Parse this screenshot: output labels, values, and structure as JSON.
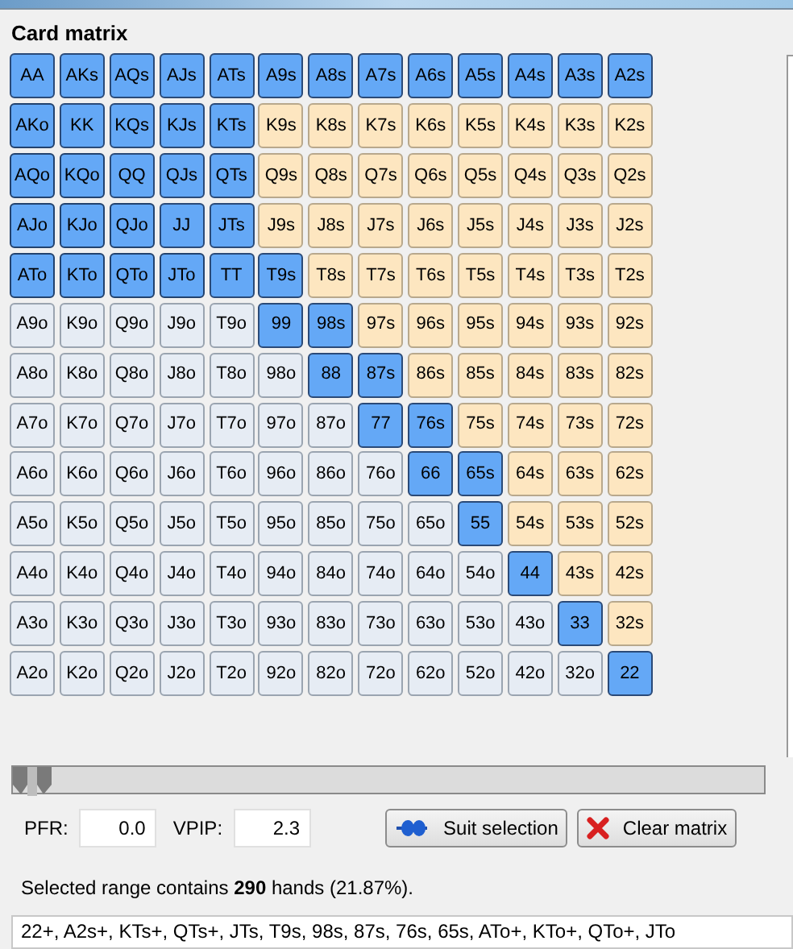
{
  "title": "Card matrix",
  "matrix": [
    [
      {
        "label": "AA",
        "kind": "pair",
        "selected": true
      },
      {
        "label": "AKs",
        "kind": "suited",
        "selected": true
      },
      {
        "label": "AQs",
        "kind": "suited",
        "selected": true
      },
      {
        "label": "AJs",
        "kind": "suited",
        "selected": true
      },
      {
        "label": "ATs",
        "kind": "suited",
        "selected": true
      },
      {
        "label": "A9s",
        "kind": "suited",
        "selected": true
      },
      {
        "label": "A8s",
        "kind": "suited",
        "selected": true
      },
      {
        "label": "A7s",
        "kind": "suited",
        "selected": true
      },
      {
        "label": "A6s",
        "kind": "suited",
        "selected": true
      },
      {
        "label": "A5s",
        "kind": "suited",
        "selected": true
      },
      {
        "label": "A4s",
        "kind": "suited",
        "selected": true
      },
      {
        "label": "A3s",
        "kind": "suited",
        "selected": true
      },
      {
        "label": "A2s",
        "kind": "suited",
        "selected": true
      }
    ],
    [
      {
        "label": "AKo",
        "kind": "offsuit",
        "selected": true
      },
      {
        "label": "KK",
        "kind": "pair",
        "selected": true
      },
      {
        "label": "KQs",
        "kind": "suited",
        "selected": true
      },
      {
        "label": "KJs",
        "kind": "suited",
        "selected": true
      },
      {
        "label": "KTs",
        "kind": "suited",
        "selected": true
      },
      {
        "label": "K9s",
        "kind": "suited",
        "selected": false
      },
      {
        "label": "K8s",
        "kind": "suited",
        "selected": false
      },
      {
        "label": "K7s",
        "kind": "suited",
        "selected": false
      },
      {
        "label": "K6s",
        "kind": "suited",
        "selected": false
      },
      {
        "label": "K5s",
        "kind": "suited",
        "selected": false
      },
      {
        "label": "K4s",
        "kind": "suited",
        "selected": false
      },
      {
        "label": "K3s",
        "kind": "suited",
        "selected": false
      },
      {
        "label": "K2s",
        "kind": "suited",
        "selected": false
      }
    ],
    [
      {
        "label": "AQo",
        "kind": "offsuit",
        "selected": true
      },
      {
        "label": "KQo",
        "kind": "offsuit",
        "selected": true
      },
      {
        "label": "QQ",
        "kind": "pair",
        "selected": true
      },
      {
        "label": "QJs",
        "kind": "suited",
        "selected": true
      },
      {
        "label": "QTs",
        "kind": "suited",
        "selected": true
      },
      {
        "label": "Q9s",
        "kind": "suited",
        "selected": false
      },
      {
        "label": "Q8s",
        "kind": "suited",
        "selected": false
      },
      {
        "label": "Q7s",
        "kind": "suited",
        "selected": false
      },
      {
        "label": "Q6s",
        "kind": "suited",
        "selected": false
      },
      {
        "label": "Q5s",
        "kind": "suited",
        "selected": false
      },
      {
        "label": "Q4s",
        "kind": "suited",
        "selected": false
      },
      {
        "label": "Q3s",
        "kind": "suited",
        "selected": false
      },
      {
        "label": "Q2s",
        "kind": "suited",
        "selected": false
      }
    ],
    [
      {
        "label": "AJo",
        "kind": "offsuit",
        "selected": true
      },
      {
        "label": "KJo",
        "kind": "offsuit",
        "selected": true
      },
      {
        "label": "QJo",
        "kind": "offsuit",
        "selected": true
      },
      {
        "label": "JJ",
        "kind": "pair",
        "selected": true
      },
      {
        "label": "JTs",
        "kind": "suited",
        "selected": true
      },
      {
        "label": "J9s",
        "kind": "suited",
        "selected": false
      },
      {
        "label": "J8s",
        "kind": "suited",
        "selected": false
      },
      {
        "label": "J7s",
        "kind": "suited",
        "selected": false
      },
      {
        "label": "J6s",
        "kind": "suited",
        "selected": false
      },
      {
        "label": "J5s",
        "kind": "suited",
        "selected": false
      },
      {
        "label": "J4s",
        "kind": "suited",
        "selected": false
      },
      {
        "label": "J3s",
        "kind": "suited",
        "selected": false
      },
      {
        "label": "J2s",
        "kind": "suited",
        "selected": false
      }
    ],
    [
      {
        "label": "ATo",
        "kind": "offsuit",
        "selected": true
      },
      {
        "label": "KTo",
        "kind": "offsuit",
        "selected": true
      },
      {
        "label": "QTo",
        "kind": "offsuit",
        "selected": true
      },
      {
        "label": "JTo",
        "kind": "offsuit",
        "selected": true
      },
      {
        "label": "TT",
        "kind": "pair",
        "selected": true
      },
      {
        "label": "T9s",
        "kind": "suited",
        "selected": true
      },
      {
        "label": "T8s",
        "kind": "suited",
        "selected": false
      },
      {
        "label": "T7s",
        "kind": "suited",
        "selected": false
      },
      {
        "label": "T6s",
        "kind": "suited",
        "selected": false
      },
      {
        "label": "T5s",
        "kind": "suited",
        "selected": false
      },
      {
        "label": "T4s",
        "kind": "suited",
        "selected": false
      },
      {
        "label": "T3s",
        "kind": "suited",
        "selected": false
      },
      {
        "label": "T2s",
        "kind": "suited",
        "selected": false
      }
    ],
    [
      {
        "label": "A9o",
        "kind": "offsuit",
        "selected": false
      },
      {
        "label": "K9o",
        "kind": "offsuit",
        "selected": false
      },
      {
        "label": "Q9o",
        "kind": "offsuit",
        "selected": false
      },
      {
        "label": "J9o",
        "kind": "offsuit",
        "selected": false
      },
      {
        "label": "T9o",
        "kind": "offsuit",
        "selected": false
      },
      {
        "label": "99",
        "kind": "pair",
        "selected": true
      },
      {
        "label": "98s",
        "kind": "suited",
        "selected": true
      },
      {
        "label": "97s",
        "kind": "suited",
        "selected": false
      },
      {
        "label": "96s",
        "kind": "suited",
        "selected": false
      },
      {
        "label": "95s",
        "kind": "suited",
        "selected": false
      },
      {
        "label": "94s",
        "kind": "suited",
        "selected": false
      },
      {
        "label": "93s",
        "kind": "suited",
        "selected": false
      },
      {
        "label": "92s",
        "kind": "suited",
        "selected": false
      }
    ],
    [
      {
        "label": "A8o",
        "kind": "offsuit",
        "selected": false
      },
      {
        "label": "K8o",
        "kind": "offsuit",
        "selected": false
      },
      {
        "label": "Q8o",
        "kind": "offsuit",
        "selected": false
      },
      {
        "label": "J8o",
        "kind": "offsuit",
        "selected": false
      },
      {
        "label": "T8o",
        "kind": "offsuit",
        "selected": false
      },
      {
        "label": "98o",
        "kind": "offsuit",
        "selected": false
      },
      {
        "label": "88",
        "kind": "pair",
        "selected": true
      },
      {
        "label": "87s",
        "kind": "suited",
        "selected": true
      },
      {
        "label": "86s",
        "kind": "suited",
        "selected": false
      },
      {
        "label": "85s",
        "kind": "suited",
        "selected": false
      },
      {
        "label": "84s",
        "kind": "suited",
        "selected": false
      },
      {
        "label": "83s",
        "kind": "suited",
        "selected": false
      },
      {
        "label": "82s",
        "kind": "suited",
        "selected": false
      }
    ],
    [
      {
        "label": "A7o",
        "kind": "offsuit",
        "selected": false
      },
      {
        "label": "K7o",
        "kind": "offsuit",
        "selected": false
      },
      {
        "label": "Q7o",
        "kind": "offsuit",
        "selected": false
      },
      {
        "label": "J7o",
        "kind": "offsuit",
        "selected": false
      },
      {
        "label": "T7o",
        "kind": "offsuit",
        "selected": false
      },
      {
        "label": "97o",
        "kind": "offsuit",
        "selected": false
      },
      {
        "label": "87o",
        "kind": "offsuit",
        "selected": false
      },
      {
        "label": "77",
        "kind": "pair",
        "selected": true
      },
      {
        "label": "76s",
        "kind": "suited",
        "selected": true
      },
      {
        "label": "75s",
        "kind": "suited",
        "selected": false
      },
      {
        "label": "74s",
        "kind": "suited",
        "selected": false
      },
      {
        "label": "73s",
        "kind": "suited",
        "selected": false
      },
      {
        "label": "72s",
        "kind": "suited",
        "selected": false
      }
    ],
    [
      {
        "label": "A6o",
        "kind": "offsuit",
        "selected": false
      },
      {
        "label": "K6o",
        "kind": "offsuit",
        "selected": false
      },
      {
        "label": "Q6o",
        "kind": "offsuit",
        "selected": false
      },
      {
        "label": "J6o",
        "kind": "offsuit",
        "selected": false
      },
      {
        "label": "T6o",
        "kind": "offsuit",
        "selected": false
      },
      {
        "label": "96o",
        "kind": "offsuit",
        "selected": false
      },
      {
        "label": "86o",
        "kind": "offsuit",
        "selected": false
      },
      {
        "label": "76o",
        "kind": "offsuit",
        "selected": false
      },
      {
        "label": "66",
        "kind": "pair",
        "selected": true
      },
      {
        "label": "65s",
        "kind": "suited",
        "selected": true
      },
      {
        "label": "64s",
        "kind": "suited",
        "selected": false
      },
      {
        "label": "63s",
        "kind": "suited",
        "selected": false
      },
      {
        "label": "62s",
        "kind": "suited",
        "selected": false
      }
    ],
    [
      {
        "label": "A5o",
        "kind": "offsuit",
        "selected": false
      },
      {
        "label": "K5o",
        "kind": "offsuit",
        "selected": false
      },
      {
        "label": "Q5o",
        "kind": "offsuit",
        "selected": false
      },
      {
        "label": "J5o",
        "kind": "offsuit",
        "selected": false
      },
      {
        "label": "T5o",
        "kind": "offsuit",
        "selected": false
      },
      {
        "label": "95o",
        "kind": "offsuit",
        "selected": false
      },
      {
        "label": "85o",
        "kind": "offsuit",
        "selected": false
      },
      {
        "label": "75o",
        "kind": "offsuit",
        "selected": false
      },
      {
        "label": "65o",
        "kind": "offsuit",
        "selected": false
      },
      {
        "label": "55",
        "kind": "pair",
        "selected": true
      },
      {
        "label": "54s",
        "kind": "suited",
        "selected": false
      },
      {
        "label": "53s",
        "kind": "suited",
        "selected": false
      },
      {
        "label": "52s",
        "kind": "suited",
        "selected": false
      }
    ],
    [
      {
        "label": "A4o",
        "kind": "offsuit",
        "selected": false
      },
      {
        "label": "K4o",
        "kind": "offsuit",
        "selected": false
      },
      {
        "label": "Q4o",
        "kind": "offsuit",
        "selected": false
      },
      {
        "label": "J4o",
        "kind": "offsuit",
        "selected": false
      },
      {
        "label": "T4o",
        "kind": "offsuit",
        "selected": false
      },
      {
        "label": "94o",
        "kind": "offsuit",
        "selected": false
      },
      {
        "label": "84o",
        "kind": "offsuit",
        "selected": false
      },
      {
        "label": "74o",
        "kind": "offsuit",
        "selected": false
      },
      {
        "label": "64o",
        "kind": "offsuit",
        "selected": false
      },
      {
        "label": "54o",
        "kind": "offsuit",
        "selected": false
      },
      {
        "label": "44",
        "kind": "pair",
        "selected": true
      },
      {
        "label": "43s",
        "kind": "suited",
        "selected": false
      },
      {
        "label": "42s",
        "kind": "suited",
        "selected": false
      }
    ],
    [
      {
        "label": "A3o",
        "kind": "offsuit",
        "selected": false
      },
      {
        "label": "K3o",
        "kind": "offsuit",
        "selected": false
      },
      {
        "label": "Q3o",
        "kind": "offsuit",
        "selected": false
      },
      {
        "label": "J3o",
        "kind": "offsuit",
        "selected": false
      },
      {
        "label": "T3o",
        "kind": "offsuit",
        "selected": false
      },
      {
        "label": "93o",
        "kind": "offsuit",
        "selected": false
      },
      {
        "label": "83o",
        "kind": "offsuit",
        "selected": false
      },
      {
        "label": "73o",
        "kind": "offsuit",
        "selected": false
      },
      {
        "label": "63o",
        "kind": "offsuit",
        "selected": false
      },
      {
        "label": "53o",
        "kind": "offsuit",
        "selected": false
      },
      {
        "label": "43o",
        "kind": "offsuit",
        "selected": false
      },
      {
        "label": "33",
        "kind": "pair",
        "selected": true
      },
      {
        "label": "32s",
        "kind": "suited",
        "selected": false
      }
    ],
    [
      {
        "label": "A2o",
        "kind": "offsuit",
        "selected": false
      },
      {
        "label": "K2o",
        "kind": "offsuit",
        "selected": false
      },
      {
        "label": "Q2o",
        "kind": "offsuit",
        "selected": false
      },
      {
        "label": "J2o",
        "kind": "offsuit",
        "selected": false
      },
      {
        "label": "T2o",
        "kind": "offsuit",
        "selected": false
      },
      {
        "label": "92o",
        "kind": "offsuit",
        "selected": false
      },
      {
        "label": "82o",
        "kind": "offsuit",
        "selected": false
      },
      {
        "label": "72o",
        "kind": "offsuit",
        "selected": false
      },
      {
        "label": "62o",
        "kind": "offsuit",
        "selected": false
      },
      {
        "label": "52o",
        "kind": "offsuit",
        "selected": false
      },
      {
        "label": "42o",
        "kind": "offsuit",
        "selected": false
      },
      {
        "label": "32o",
        "kind": "offsuit",
        "selected": false
      },
      {
        "label": "22",
        "kind": "pair",
        "selected": true
      }
    ]
  ],
  "slider": {
    "level": 0
  },
  "fields": [
    {
      "label": "PFR:",
      "value": "0.0"
    },
    {
      "label": "VPIP:",
      "value": "2.3"
    }
  ],
  "buttons": [
    {
      "label": "Suit selection",
      "kind": "suits"
    },
    {
      "label": "Clear matrix",
      "kind": "clear"
    }
  ],
  "summary": "Selected range contains **290** hands (21.87%).",
  "range_text": "22+, A2s+, KTs+, QTs+, JTs, T9s, 98s, 87s, 76s, 65s, ATo+, KTo+, QTo+, JTo"
}
